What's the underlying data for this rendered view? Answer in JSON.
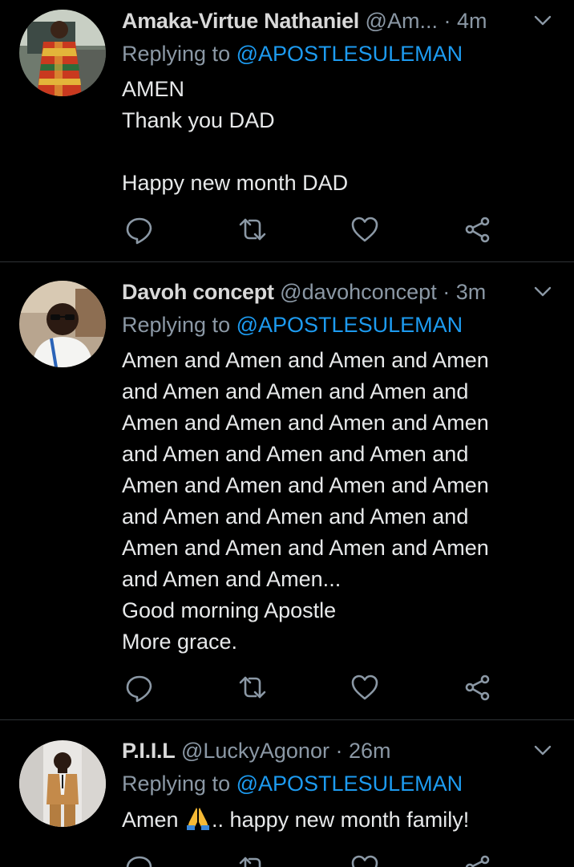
{
  "tweets": [
    {
      "name": "Amaka-Virtue Nathaniel",
      "handle": "@Am...",
      "separator": "·",
      "time": "4m",
      "replying_prefix": "Replying to",
      "replying_to": "@APOSTLESULEMAN",
      "lines": [
        "AMEN",
        "Thank you DAD",
        "",
        "Happy new month DAD"
      ],
      "avatar_icon": "avatar-woman-kente-dress"
    },
    {
      "name": "Davoh concept",
      "handle": "@davohconcept",
      "separator": "·",
      "time": "3m",
      "replying_prefix": "Replying to",
      "replying_to": "@APOSTLESULEMAN",
      "lines": [
        "Amen and Amen and Amen and Amen",
        "and Amen and Amen and Amen and",
        "Amen and Amen and Amen and Amen",
        "and Amen and Amen and Amen and",
        "Amen and Amen and Amen and Amen",
        "and Amen and Amen and Amen and",
        "Amen and Amen and Amen and Amen",
        "and Amen and Amen...",
        "Good morning Apostle",
        "More grace."
      ],
      "avatar_icon": "avatar-man-glasses"
    },
    {
      "name": "P.I.I.L",
      "handle": "@LuckyAgonor",
      "separator": "·",
      "time": "26m",
      "replying_prefix": "Replying to",
      "replying_to": "@APOSTLESULEMAN",
      "text_before_emoji": "Amen ",
      "emoji": "folded-hands-emoji",
      "text_after_emoji": ".. happy new month family!",
      "avatar_icon": "avatar-man-tan-suit"
    }
  ],
  "action_icons": [
    "reply-icon",
    "retweet-icon",
    "like-icon",
    "share-icon",
    "more-chevron-icon"
  ],
  "colors": {
    "background": "#000000",
    "text": "#e7e9ea",
    "muted": "#8b98a5",
    "mention": "#1d9bf0",
    "divider": "#2f3336"
  }
}
